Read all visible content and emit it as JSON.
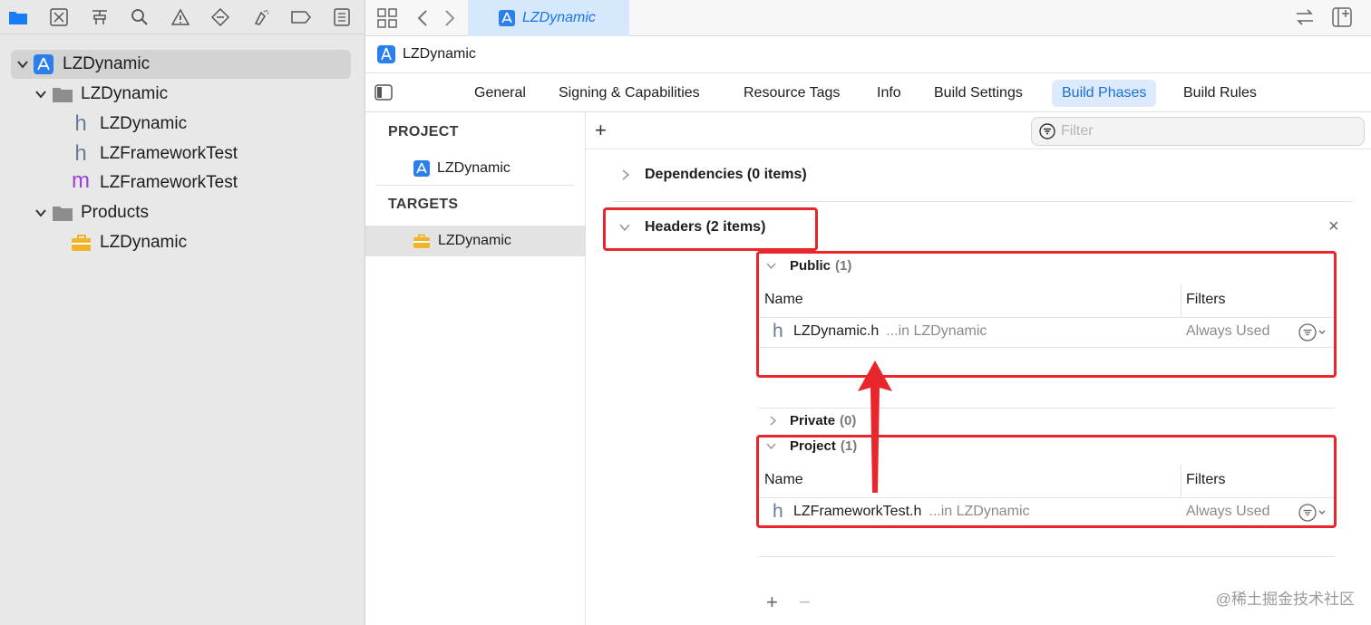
{
  "navigator": {
    "toolbar_icons": [
      "folder-icon",
      "source-control-icon",
      "symbol-icon",
      "find-icon",
      "issue-icon",
      "test-icon",
      "debug-icon",
      "breakpoint-icon",
      "report-icon"
    ],
    "tree": [
      {
        "label": "LZDynamic",
        "icon": "app-project-icon",
        "expanded": true,
        "selected": true
      },
      {
        "label": "LZDynamic",
        "icon": "group-folder-icon",
        "expanded": true
      },
      {
        "label": "LZDynamic",
        "icon": "header-h-icon"
      },
      {
        "label": "LZFrameworkTest",
        "icon": "header-h-icon"
      },
      {
        "label": "LZFrameworkTest",
        "icon": "implementation-m-icon"
      },
      {
        "label": "Products",
        "icon": "group-folder-icon",
        "expanded": true
      },
      {
        "label": "LZDynamic",
        "icon": "framework-toolbox-icon"
      }
    ]
  },
  "editor": {
    "active_tab": "LZDynamic",
    "jumpbar_title": "LZDynamic",
    "tabs": [
      "General",
      "Signing & Capabilities",
      "Resource Tags",
      "Info",
      "Build Settings",
      "Build Phases",
      "Build Rules"
    ],
    "active_tab_index": 5
  },
  "targets": {
    "project_header": "PROJECT",
    "project_item": "LZDynamic",
    "targets_header": "TARGETS",
    "target_item": "LZDynamic"
  },
  "phases": {
    "add_label": "+",
    "filter_placeholder": "Filter",
    "dependencies_title": "Dependencies (0 items)",
    "headers_title": "Headers (2 items)",
    "close_label": "×",
    "public": {
      "title": "Public",
      "count": "(1)"
    },
    "private": {
      "title": "Private",
      "count": "(0)"
    },
    "project": {
      "title": "Project",
      "count": "(1)"
    },
    "col_name": "Name",
    "col_filters": "Filters",
    "public_row": {
      "file": "LZDynamic.h",
      "location": "...in LZDynamic",
      "filter": "Always Used"
    },
    "project_row": {
      "file": "LZFrameworkTest.h",
      "location": "...in LZDynamic",
      "filter": "Always Used"
    },
    "add_button": "+",
    "remove_button": "−"
  },
  "watermark": "@稀土掘金技术社区",
  "colors": {
    "accent": "#1a73e8",
    "highlight": "#e8262c",
    "selection": "#d3d3d3"
  }
}
